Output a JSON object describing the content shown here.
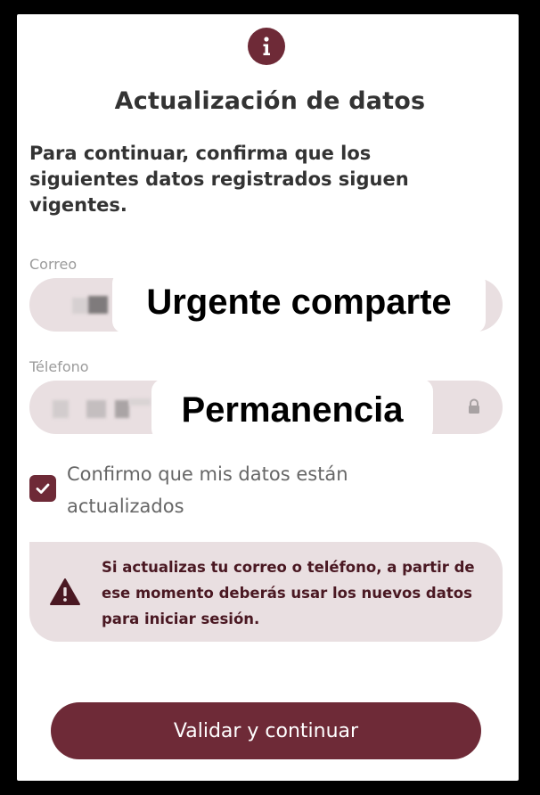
{
  "dialog": {
    "title": "Actualización de datos",
    "intro": "Para continuar, confirma que los siguientes datos registrados siguen vigentes."
  },
  "fields": {
    "email_label": "Correo",
    "phone_label": "Télefono"
  },
  "overlays": {
    "top": "Urgente comparte",
    "bottom": "Permanencia"
  },
  "confirm": {
    "label": "Confirmo que mis datos están actualizados",
    "checked": true
  },
  "notice": {
    "text": "Si actualizas tu correo o teléfono, a partir de ese momento deberás usar los nuevos datos para iniciar sesión."
  },
  "actions": {
    "primary_label": "Validar y continuar"
  },
  "icons": {
    "info": "info-icon",
    "lock": "lock-icon",
    "check": "check-icon",
    "warning": "warning-icon"
  },
  "colors": {
    "brand": "#6e2a37",
    "field_bg": "#e9dfe1",
    "text": "#333333"
  }
}
